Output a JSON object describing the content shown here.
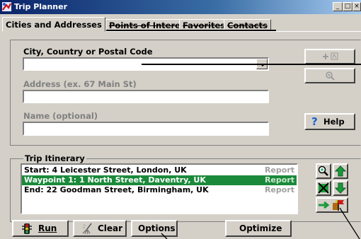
{
  "window": {
    "title": "Trip Planner"
  },
  "tabs": [
    {
      "label": "Cities and Addresses"
    },
    {
      "label": "Points of Interest"
    },
    {
      "label": "Favorites"
    },
    {
      "label": "Contacts"
    }
  ],
  "form": {
    "city_label": "City, Country or Postal Code",
    "city_value": "",
    "address_label": "Address (ex. 67 Main St)",
    "address_value": "",
    "name_label": "Name (optional)",
    "name_value": "",
    "help_label": "Help"
  },
  "itinerary": {
    "group_label": "Trip Itinerary",
    "rows": [
      {
        "text": "Start: 4 Leicester Street, London, UK",
        "report": "Report",
        "selected": false
      },
      {
        "text": "Waypoint 1: 1 North Street, Daventry, UK",
        "report": "Report",
        "selected": true
      },
      {
        "text": "End: 22 Goodman Street, Birmingham, UK",
        "report": "Report",
        "selected": false
      }
    ]
  },
  "bottom_buttons": {
    "run_label": "Run",
    "clear_label": "Clear",
    "options_label": "Options",
    "optimize_label": "Optimize"
  },
  "colors": {
    "selection": "#1a8a3a",
    "titlebar": "#0a246a",
    "help_icon": "#1a5fd0"
  },
  "icons": {
    "add_location": "add-location-icon",
    "zoom": "magnifier-icon",
    "move_up": "arrow-up-icon",
    "move_down": "arrow-down-icon",
    "remove": "remove-stop-icon",
    "add_to_route": "route-flag-icon",
    "run": "traffic-light-icon",
    "clear": "broom-icon"
  }
}
